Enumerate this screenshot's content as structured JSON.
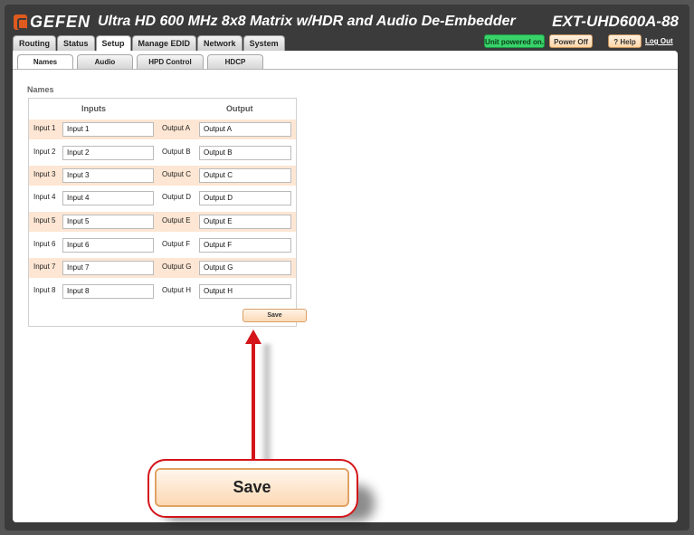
{
  "header": {
    "brand": "GEFEN",
    "title": "Ultra HD 600 MHz 8x8 Matrix w/HDR and Audio De-Embedder",
    "model": "EXT-UHD600A-88",
    "unit_status": "Unit powered on.",
    "power_off": "Power Off",
    "help": "? Help",
    "logout": "Log Out"
  },
  "main_tabs": [
    "Routing",
    "Status",
    "Setup",
    "Manage EDID",
    "Network",
    "System"
  ],
  "sub_tabs": [
    "Names",
    "Audio",
    "HPD Control",
    "HDCP"
  ],
  "section_title": "Names",
  "columns": {
    "inputs": "Inputs",
    "output": "Output"
  },
  "rows": [
    {
      "in_label": "Input 1",
      "in_value": "Input 1",
      "out_label": "Output A",
      "out_value": "Output A"
    },
    {
      "in_label": "Input 2",
      "in_value": "Input 2",
      "out_label": "Output B",
      "out_value": "Output B"
    },
    {
      "in_label": "Input 3",
      "in_value": "Input 3",
      "out_label": "Output C",
      "out_value": "Output C"
    },
    {
      "in_label": "Input 4",
      "in_value": "Input 4",
      "out_label": "Output D",
      "out_value": "Output D"
    },
    {
      "in_label": "Input 5",
      "in_value": "Input 5",
      "out_label": "Output E",
      "out_value": "Output E"
    },
    {
      "in_label": "Input 6",
      "in_value": "Input 6",
      "out_label": "Output F",
      "out_value": "Output F"
    },
    {
      "in_label": "Input 7",
      "in_value": "Input 7",
      "out_label": "Output G",
      "out_value": "Output G"
    },
    {
      "in_label": "Input 8",
      "in_value": "Input 8",
      "out_label": "Output H",
      "out_value": "Output H"
    }
  ],
  "save_label": "Save",
  "callout_label": "Save",
  "colors": {
    "accent_red": "#d4151a",
    "row_shade": "#fde6d3",
    "status_green": "#39d36a",
    "brand_orange": "#e05a1e"
  }
}
